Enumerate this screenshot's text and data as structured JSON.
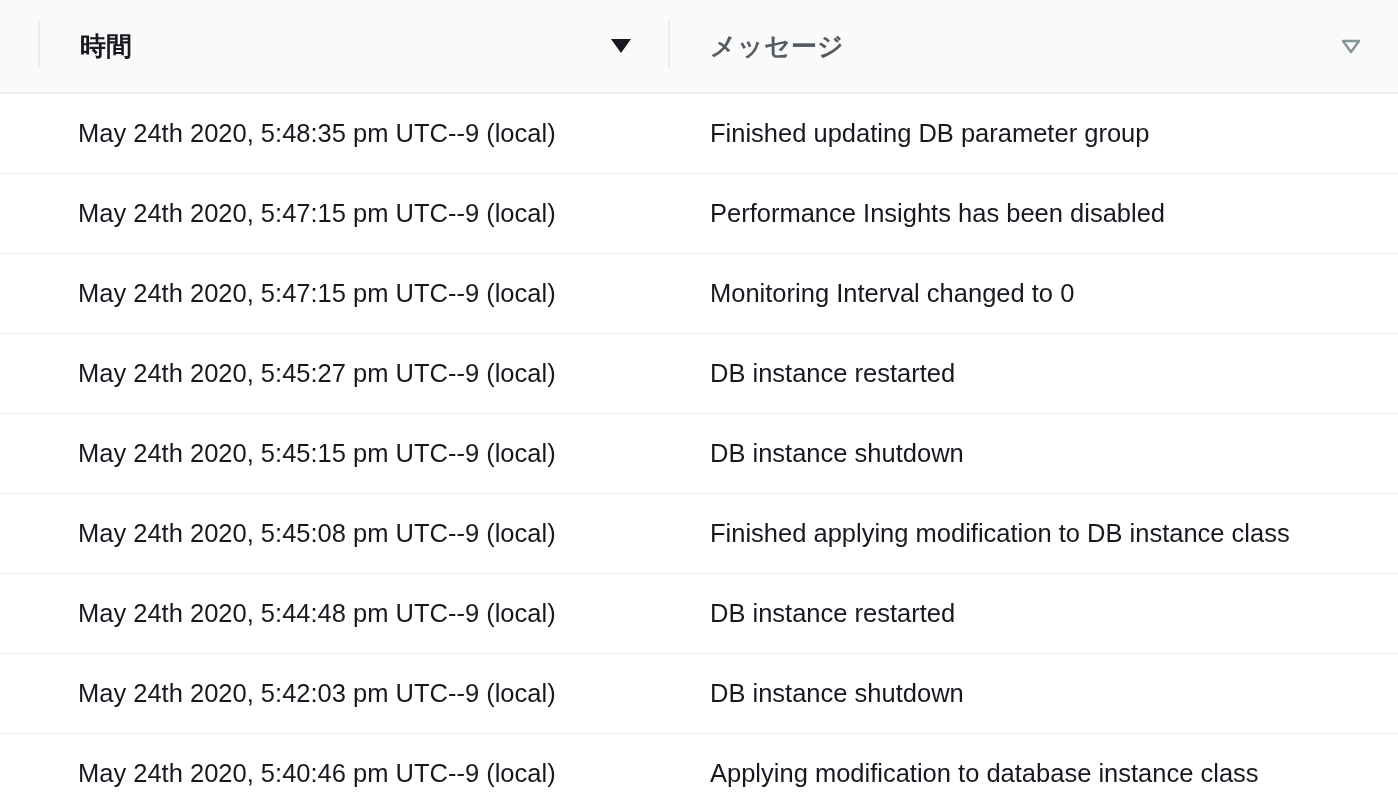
{
  "table": {
    "columns": [
      {
        "label": "時間",
        "sorted": true
      },
      {
        "label": "メッセージ",
        "sorted": false
      }
    ],
    "rows": [
      {
        "time": "May 24th 2020, 5:48:35 pm UTC--9 (local)",
        "message": "Finished updating DB parameter group"
      },
      {
        "time": "May 24th 2020, 5:47:15 pm UTC--9 (local)",
        "message": "Performance Insights has been disabled"
      },
      {
        "time": "May 24th 2020, 5:47:15 pm UTC--9 (local)",
        "message": "Monitoring Interval changed to 0"
      },
      {
        "time": "May 24th 2020, 5:45:27 pm UTC--9 (local)",
        "message": "DB instance restarted"
      },
      {
        "time": "May 24th 2020, 5:45:15 pm UTC--9 (local)",
        "message": "DB instance shutdown"
      },
      {
        "time": "May 24th 2020, 5:45:08 pm UTC--9 (local)",
        "message": "Finished applying modification to DB instance class"
      },
      {
        "time": "May 24th 2020, 5:44:48 pm UTC--9 (local)",
        "message": "DB instance restarted"
      },
      {
        "time": "May 24th 2020, 5:42:03 pm UTC--9 (local)",
        "message": "DB instance shutdown"
      },
      {
        "time": "May 24th 2020, 5:40:46 pm UTC--9 (local)",
        "message": "Applying modification to database instance class"
      }
    ]
  }
}
